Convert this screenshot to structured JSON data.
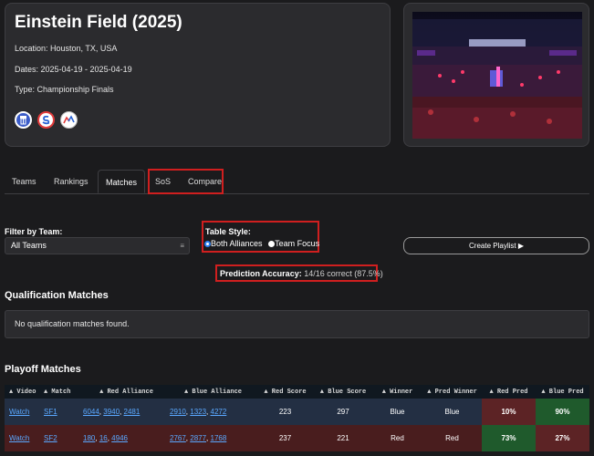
{
  "event": {
    "title": "Einstein Field (2025)",
    "location": "Location: Houston, TX, USA",
    "dates": "Dates: 2025-04-19 - 2025-04-19",
    "type": "Type: Championship Finals",
    "icons": [
      "tba-icon",
      "statbotics-icon",
      "frc-events-icon"
    ]
  },
  "tabs": [
    "Teams",
    "Rankings",
    "Matches",
    "SoS",
    "Compare"
  ],
  "filter": {
    "label": "Filter by Team:",
    "value": "All Teams"
  },
  "table_style": {
    "label": "Table Style:",
    "options": [
      "Both Alliances",
      "Team Focus"
    ],
    "selected": "Both Alliances"
  },
  "playlist_button": "Create Playlist ▶",
  "prediction": {
    "label": "Prediction Accuracy:",
    "value": "14/16 correct (87.5%)"
  },
  "qualification": {
    "heading": "Qualification Matches",
    "empty": "No qualification matches found."
  },
  "playoff": {
    "heading": "Playoff Matches",
    "columns": [
      "Video",
      "Match",
      "Red Alliance",
      "Blue Alliance",
      "Red Score",
      "Blue Score",
      "Winner",
      "Pred Winner",
      "Red Pred",
      "Blue Pred"
    ],
    "rows": [
      {
        "video": "Watch",
        "match": "SF1",
        "red": [
          "6044",
          "3940",
          "2481"
        ],
        "blue": [
          "2910",
          "1323",
          "4272"
        ],
        "red_score": "223",
        "blue_score": "297",
        "winner": "Blue",
        "pred_winner": "Blue",
        "red_pred": "10%",
        "blue_pred": "90%"
      },
      {
        "video": "Watch",
        "match": "SF2",
        "red": [
          "180",
          "16",
          "4946"
        ],
        "blue": [
          "2767",
          "2877",
          "1768"
        ],
        "red_score": "237",
        "blue_score": "221",
        "winner": "Red",
        "pred_winner": "Red",
        "red_pred": "73%",
        "blue_pred": "27%"
      }
    ]
  },
  "colors": {
    "highlight": "#d01f1f",
    "link": "#5aa8ff",
    "blue_row": "#232f43",
    "red_row": "#491d1e",
    "pred_high": "#1f5a2c",
    "pred_low": "#5c2325"
  }
}
